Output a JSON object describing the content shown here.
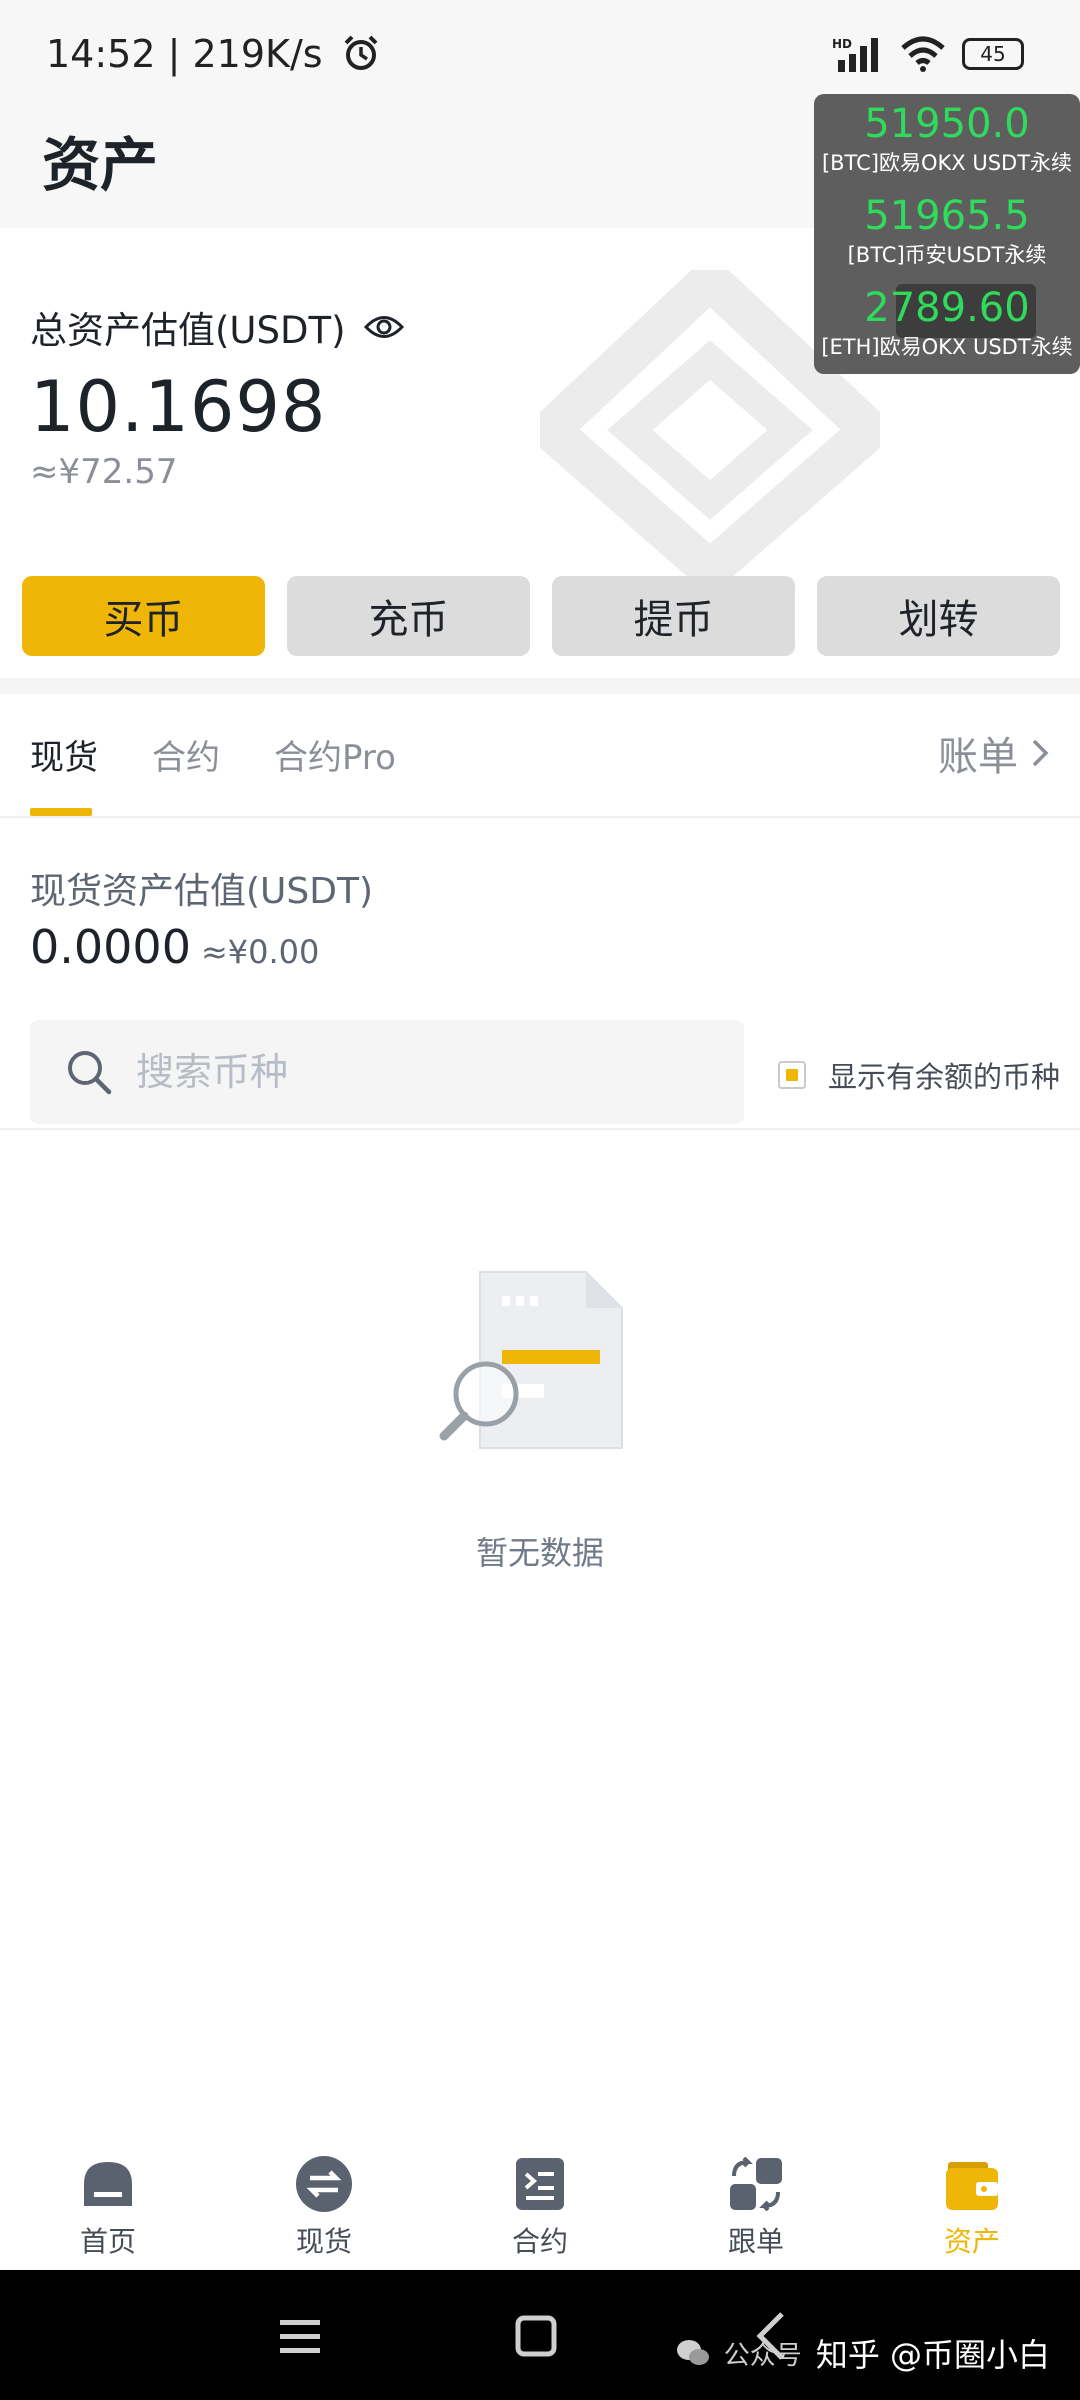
{
  "status_bar": {
    "time": "14:52",
    "speed": "219K/s",
    "battery": "45"
  },
  "header": {
    "title": "资产"
  },
  "ticker": [
    {
      "price": "51950.0",
      "name": "[BTC]欧易OKX USDT永续"
    },
    {
      "price": "51965.5",
      "name": "[BTC]币安USDT永续"
    },
    {
      "price": "2789.60",
      "name": "[ETH]欧易OKX USDT永续"
    }
  ],
  "total": {
    "label": "总资产估值(USDT)",
    "value": "10.1698",
    "cny": "≈¥72.57"
  },
  "actions": {
    "buy": "买币",
    "deposit": "充币",
    "withdraw": "提币",
    "transfer": "划转"
  },
  "tabs": {
    "spot": "现货",
    "futures": "合约",
    "futures_pro": "合约Pro",
    "bill": "账单"
  },
  "spot": {
    "label": "现货资产估值(USDT)",
    "value": "0.0000",
    "cny": "≈¥0.00",
    "search_placeholder": "搜索币种",
    "filter_label": "显示有余额的币种"
  },
  "empty": {
    "text": "暂无数据"
  },
  "bottom_nav": {
    "home": "首页",
    "spot": "现货",
    "futures": "合约",
    "copy": "跟单",
    "assets": "资产"
  },
  "credit": {
    "prefix": "公众号",
    "text": "知乎 @币圈小白"
  },
  "colors": {
    "accent": "#efb608",
    "ticker_green": "#2fdb5a"
  }
}
